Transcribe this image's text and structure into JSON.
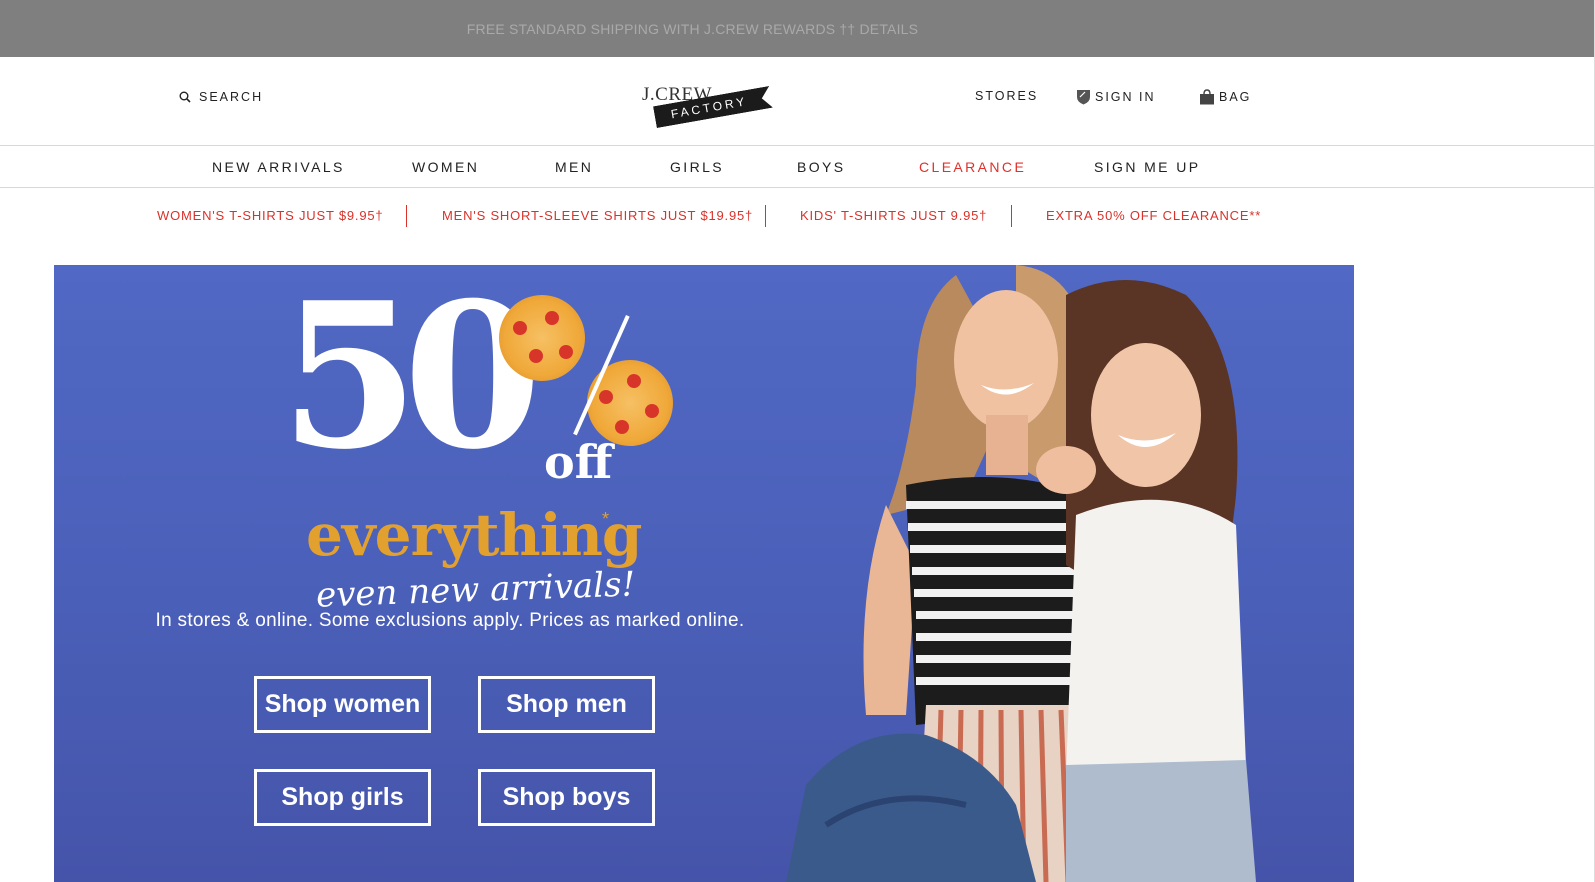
{
  "topbar": {
    "text": "FREE STANDARD SHIPPING WITH J.CREW REWARDS",
    "mark": "††",
    "details": "DETAILS"
  },
  "header": {
    "search_label": "SEARCH",
    "logo_top": "J.CREW",
    "logo_ribbon": "FACTORY",
    "stores_label": "STORES",
    "signin_label": "SIGN IN",
    "bag_label": "BAG"
  },
  "nav": {
    "items": [
      {
        "label": "NEW ARRIVALS"
      },
      {
        "label": "WOMEN"
      },
      {
        "label": "MEN"
      },
      {
        "label": "GIRLS"
      },
      {
        "label": "BOYS"
      },
      {
        "label": "CLEARANCE"
      },
      {
        "label": "SIGN ME UP"
      }
    ]
  },
  "promos": [
    {
      "label": "WOMEN'S T-SHIRTS JUST $9.95†"
    },
    {
      "label": "MEN'S SHORT-SLEEVE SHIRTS JUST $19.95†"
    },
    {
      "label": "KIDS' T-SHIRTS JUST 9.95†"
    },
    {
      "label": "EXTRA 50% OFF CLEARANCE**"
    }
  ],
  "hero": {
    "big_number": "50",
    "off_label": "off",
    "everything_label": "everything",
    "asterisk": "*",
    "subline": "even new arrivals!",
    "fine_print": "In stores & online. Some exclusions apply. Prices as marked online.",
    "buttons": {
      "women": "Shop women",
      "men": "Shop men",
      "girls": "Shop girls",
      "boys": "Shop boys"
    }
  },
  "colors": {
    "topbar_bg": "#7f7f7f",
    "promo_red": "#d9322a",
    "hero_blue": "#4a5fb8",
    "hero_gold": "#e2a02f"
  }
}
